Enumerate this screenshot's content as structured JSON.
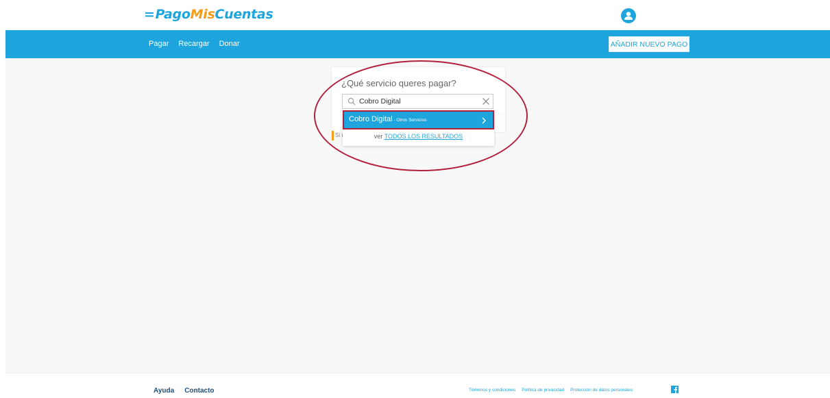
{
  "brand": {
    "bars": "=",
    "word1": "Pago",
    "word2": "Mis",
    "word3": "Cuentas",
    "primary_color": "#1ea5dd",
    "accent_color": "#f59c1a"
  },
  "header": {
    "avatar_icon": "user-circle-icon"
  },
  "nav": {
    "items": [
      {
        "label": "Pagar"
      },
      {
        "label": "Recargar"
      },
      {
        "label": "Donar"
      }
    ],
    "add_payment_label": "AÑADIR NUEVO PAGO"
  },
  "search": {
    "title": "¿Qué servicio queres pagar?",
    "value": "Cobro Digital",
    "search_icon": "search-icon",
    "clear_icon": "close-icon",
    "note": "Si r",
    "results": [
      {
        "name": "Cobro Digital",
        "separator": " - ",
        "category": "Otros Servicios"
      }
    ],
    "see_all_prefix": "ver ",
    "see_all_link": "TODOS LOS RESULTADOS",
    "highlight_color": "#b3203c"
  },
  "footer": {
    "links": [
      {
        "label": "Ayuda"
      },
      {
        "label": "Contacto"
      }
    ],
    "legal": [
      {
        "label": "Términos y condiciones"
      },
      {
        "label": "Política de privacidad"
      },
      {
        "label": "Protección de datos personales"
      }
    ],
    "social_icon": "facebook-icon"
  }
}
